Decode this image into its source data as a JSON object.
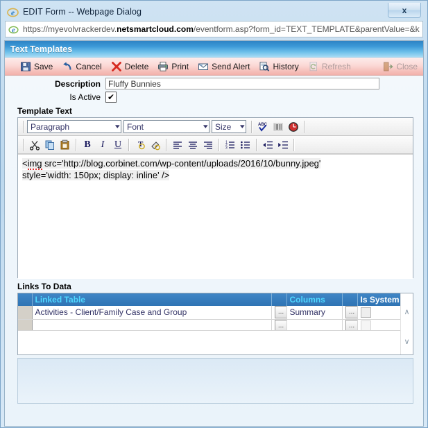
{
  "dialog": {
    "title": "EDIT Form -- Webpage Dialog",
    "close_label": "x",
    "browser_icon": "ie-logo-icon"
  },
  "address": {
    "scheme": "https://myevolvrackerdev.",
    "domain": "netsmartcloud.com",
    "path": "/eventform.asp?form_id=TEXT_TEMPLATE&parentValue=&ke",
    "icon": "ie-page-icon"
  },
  "app": {
    "header_title": "Text Templates"
  },
  "toolbar": {
    "buttons": [
      {
        "label": "Save",
        "icon": "save-disk-icon",
        "disabled": false
      },
      {
        "label": "Cancel",
        "icon": "undo-arrow-icon",
        "disabled": false
      },
      {
        "label": "Delete",
        "icon": "red-x-icon",
        "disabled": false
      },
      {
        "label": "Print",
        "icon": "printer-icon",
        "disabled": false
      },
      {
        "label": "Send Alert",
        "icon": "envelope-icon",
        "disabled": false
      },
      {
        "label": "History",
        "icon": "magnifier-icon",
        "disabled": false
      },
      {
        "label": "Refresh",
        "icon": "refresh-page-icon",
        "disabled": true
      }
    ],
    "close": {
      "label": "Close",
      "icon": "exit-door-icon",
      "disabled": true
    }
  },
  "form": {
    "description_label": "Description",
    "description_value": "Fluffy Bunnies",
    "description_placeholder": "",
    "isactive_label": "Is Active",
    "isactive_checked": true,
    "isactive_mark": "✔",
    "template_text_label": "Template Text"
  },
  "editor": {
    "selects": [
      {
        "name": "paragraph",
        "value": "Paragraph"
      },
      {
        "name": "font",
        "value": "Font"
      },
      {
        "name": "size",
        "value": "Size"
      }
    ],
    "tools_row1": [
      {
        "icon": "spellcheck-abc-icon"
      },
      {
        "icon": "barcode-icon"
      },
      {
        "icon": "clock-icon"
      }
    ],
    "tools_row2": [
      {
        "icon": "cut-scissors-icon",
        "glyph": "✂"
      },
      {
        "icon": "copy-icon",
        "glyph": "❐"
      },
      {
        "icon": "paste-icon",
        "glyph": "ὌB"
      },
      {
        "icon": "bold-icon",
        "glyph": "B"
      },
      {
        "icon": "italic-icon",
        "glyph": "I"
      },
      {
        "icon": "underline-icon",
        "glyph": "U"
      },
      {
        "icon": "text-color-icon",
        "glyph": "T"
      },
      {
        "icon": "highlight-fill-icon",
        "glyph": "◢"
      },
      {
        "icon": "align-left-icon",
        "glyph": "≡"
      },
      {
        "icon": "align-center-icon",
        "glyph": "≡"
      },
      {
        "icon": "align-right-icon",
        "glyph": "≡"
      },
      {
        "icon": "ordered-list-icon",
        "glyph": "≡"
      },
      {
        "icon": "bulleted-list-icon",
        "glyph": "≡"
      },
      {
        "icon": "outdent-icon",
        "glyph": "≡"
      },
      {
        "icon": "indent-icon",
        "glyph": "≡"
      }
    ],
    "content_line1_misspelled": "img",
    "content_line1_rest": " src='http://blog.corbinet.com/wp-content/uploads/2016/10/bunny.jpeg'",
    "content_line1_prefix": "<",
    "content_line2": "style='width: 150px; display: inline' />"
  },
  "links_section": {
    "label": "Links To Data",
    "columns": [
      "",
      "Linked Table",
      "",
      "Columns",
      "",
      "Is System"
    ],
    "rows": [
      {
        "linked_table": "Activities - Client/Family Case and Group",
        "ellipsis1": "...",
        "columns_value": "Summary",
        "ellipsis2": "...",
        "is_system_checked": false
      },
      {
        "linked_table": "",
        "ellipsis1": "...",
        "columns_value": "",
        "ellipsis2": "...",
        "is_system_checked": false
      }
    ],
    "scroll_up": "∧",
    "scroll_down": "∨"
  },
  "colors": {
    "header_blue": "#2d83c4",
    "toolbar_pink": "#f6c2bd",
    "grid_header_blue": "#2f74b4",
    "grid_header_text": "#4fd8ff",
    "body_bg": "#eaf3fa"
  }
}
